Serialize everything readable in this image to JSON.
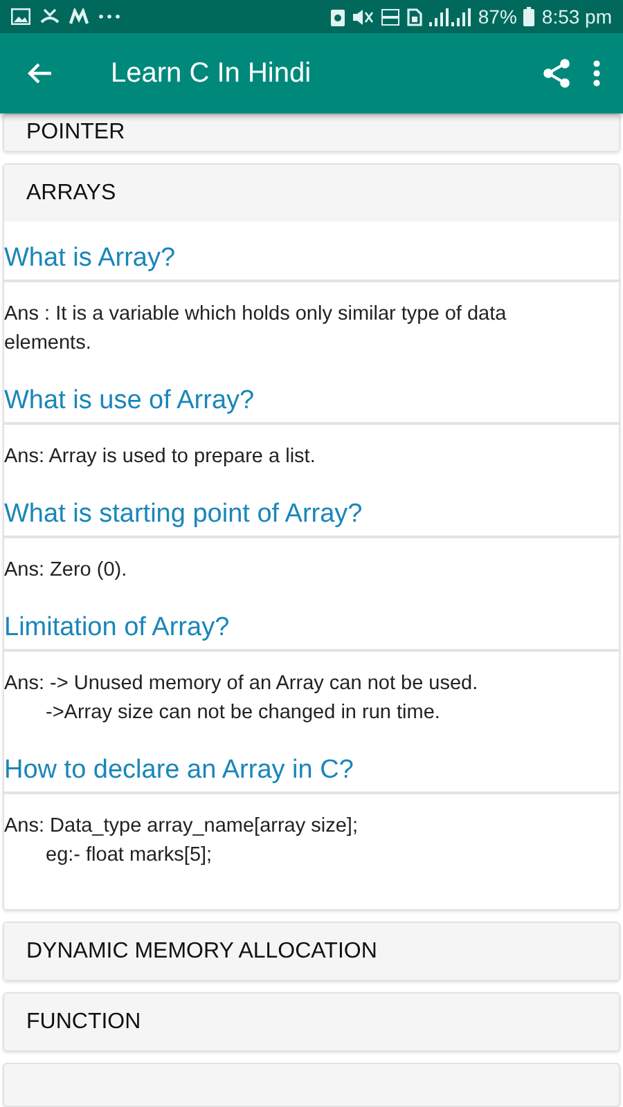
{
  "status_bar": {
    "battery": "87%",
    "time": "8:53 pm"
  },
  "app_bar": {
    "title": "Learn C In Hindi"
  },
  "sections": [
    {
      "title": "POINTER"
    },
    {
      "title": "ARRAYS",
      "items": [
        {
          "question": "What is Array?",
          "answer": [
            "Ans : It is a variable which holds only similar type of data elements."
          ]
        },
        {
          "question": "What is use of Array?",
          "answer": [
            "Ans: Array is used to prepare a list."
          ]
        },
        {
          "question": "What is starting point of Array?",
          "answer": [
            "Ans: Zero (0)."
          ]
        },
        {
          "question": "Limitation of Array?",
          "answer": [
            "Ans: -> Unused memory of an Array can not be used.",
            "->Array size can not be changed in run time."
          ]
        },
        {
          "question": "How to declare an Array in C?",
          "answer": [
            "Ans: Data_type array_name[array size];",
            "eg:- float marks[5];"
          ]
        }
      ]
    },
    {
      "title": "DYNAMIC MEMORY ALLOCATION"
    },
    {
      "title": "FUNCTION"
    }
  ]
}
